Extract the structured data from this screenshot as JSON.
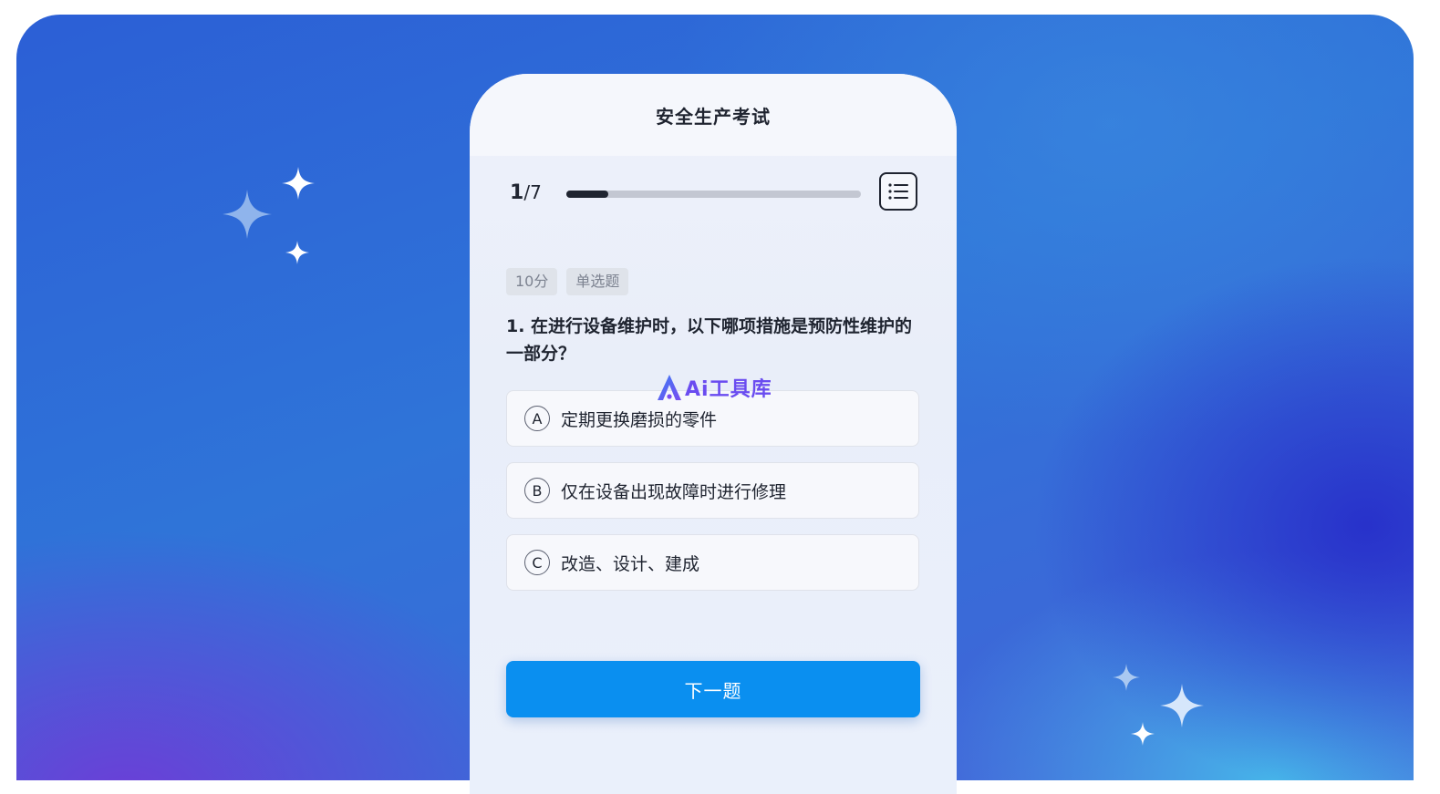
{
  "exam": {
    "title": "安全生产考试",
    "progress": {
      "current": "1",
      "separator": "/",
      "total": "7",
      "fraction": 0.143
    },
    "question": {
      "score_tag": "10分",
      "type_tag": "单选题",
      "text": "1. 在进行设备维护时，以下哪项措施是预防性维护的一部分？"
    },
    "options": [
      {
        "letter": "A",
        "text": "定期更换磨损的零件"
      },
      {
        "letter": "B",
        "text": "仅在设备出现故障时进行修理"
      },
      {
        "letter": "C",
        "text": "改造、设计、建成"
      }
    ],
    "next_label": "下一题"
  },
  "watermark": {
    "text": "Ai工具库"
  },
  "colors": {
    "primary_button": "#0a8ff0",
    "watermark": "#6a4cf0",
    "text_dark": "#1f2430"
  },
  "icons": {
    "list": "question-list-icon",
    "sparkle": "sparkle-icon"
  }
}
